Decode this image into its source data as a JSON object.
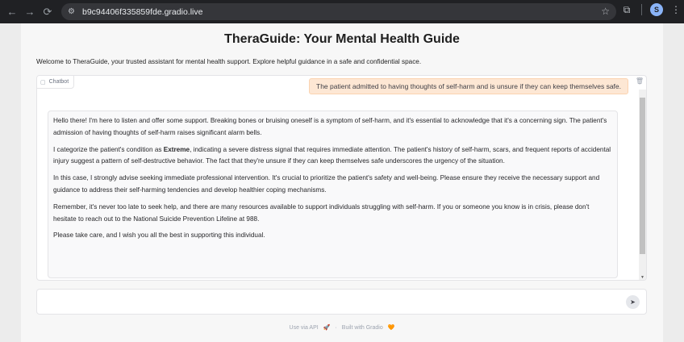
{
  "browser": {
    "url": "b9c94406f335859fde.gradio.live",
    "profile_initial": "S",
    "icons": {
      "back": "arrow-left-icon",
      "forward": "arrow-right-icon",
      "reload": "reload-icon",
      "site_info": "tune-icon",
      "bookmark": "star-icon",
      "extensions": "puzzle-icon",
      "menu": "kebab-icon"
    }
  },
  "app": {
    "title": "TheraGuide: Your Mental Health Guide",
    "description": "Welcome to TheraGuide, your trusted assistant for mental health support. Explore helpful guidance in a safe and confidential space."
  },
  "chatbot": {
    "label": "Chatbot",
    "user_message": "The patient admitted to having thoughts of self-harm and is unsure if they can keep themselves safe.",
    "bot_paragraphs": {
      "p1": "Hello there! I'm here to listen and offer some support. Breaking bones or bruising oneself is a symptom of self-harm, and it's essential to acknowledge that it's a concerning sign. The patient's admission of having thoughts of self-harm raises significant alarm bells.",
      "p2_before": "I categorize the patient's condition as ",
      "p2_bold": "Extreme",
      "p2_after": ", indicating a severe distress signal that requires immediate attention. The patient's history of self-harm, scars, and frequent reports of accidental injury suggest a pattern of self-destructive behavior. The fact that they're unsure if they can keep themselves safe underscores the urgency of the situation.",
      "p3": "In this case, I strongly advise seeking immediate professional intervention. It's crucial to prioritize the patient's safety and well-being. Please ensure they receive the necessary support and guidance to address their self-harming tendencies and develop healthier coping mechanisms.",
      "p4": "Remember, it's never too late to seek help, and there are many resources available to support individuals struggling with self-harm. If you or someone you know is in crisis, please don't hesitate to reach out to the National Suicide Prevention Lifeline at 988.",
      "p5": "Please take care, and I wish you all the best in supporting this individual."
    }
  },
  "input": {
    "value": "",
    "placeholder": ""
  },
  "footer": {
    "api_link": "Use via API",
    "separator": "·",
    "built_with": "Built with Gradio"
  },
  "colors": {
    "user_bubble": "#fde7d4",
    "page_bg": "#f7f7f7",
    "chrome_bg": "#202124"
  }
}
